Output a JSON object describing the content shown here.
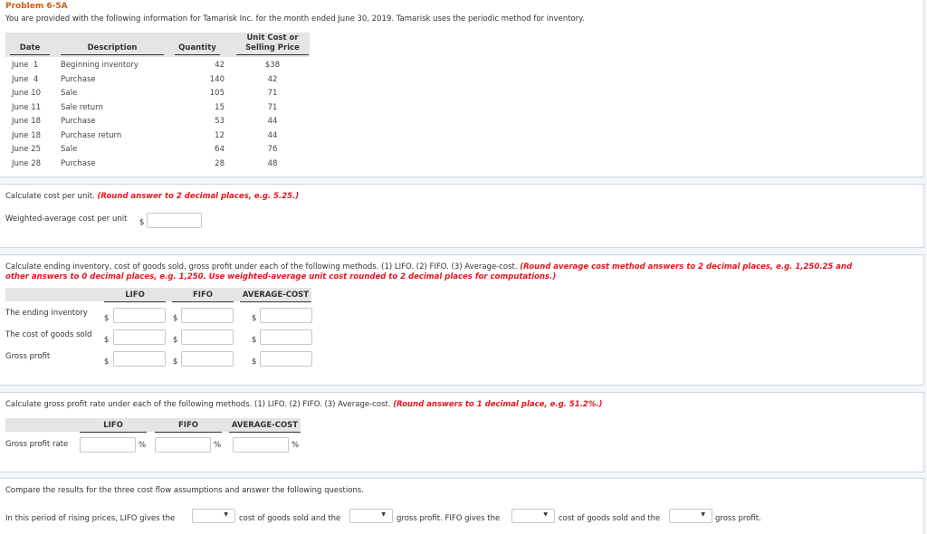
{
  "problem": {
    "title": "Problem 6-5A",
    "intro": "You are provided with the following information for Tamarisk Inc. for the month ended June 30, 2019. Tamarisk uses the periodic method for inventory."
  },
  "table": {
    "headers": {
      "date": "Date",
      "description": "Description",
      "quantity": "Quantity",
      "unit_cost_line1": "Unit Cost or",
      "unit_cost_line2": "Selling Price"
    },
    "rows": [
      {
        "date": "June  1",
        "description": "Beginning inventory",
        "quantity": "42",
        "price": "$38"
      },
      {
        "date": "June  4",
        "description": "Purchase",
        "quantity": "140",
        "price": "42"
      },
      {
        "date": "June 10",
        "description": "Sale",
        "quantity": "105",
        "price": "71"
      },
      {
        "date": "June 11",
        "description": "Sale return",
        "quantity": "15",
        "price": "71"
      },
      {
        "date": "June 18",
        "description": "Purchase",
        "quantity": "53",
        "price": "44"
      },
      {
        "date": "June 18",
        "description": "Purchase return",
        "quantity": "12",
        "price": "44"
      },
      {
        "date": "June 25",
        "description": "Sale",
        "quantity": "64",
        "price": "76"
      },
      {
        "date": "June 28",
        "description": "Purchase",
        "quantity": "28",
        "price": "48"
      }
    ]
  },
  "part1": {
    "instruction": "Calculate cost per unit.",
    "hint": "(Round answer to 2 decimal places, e.g. 5.25.)",
    "label": "Weighted-average cost per unit",
    "currency": "$",
    "value": ""
  },
  "part2": {
    "instruction": "Calculate ending inventory, cost of goods sold, gross profit under each of the following methods. (1) LIFO. (2) FIFO. (3) Average-cost.",
    "hint_line1": "(Round average cost method answers to 2 decimal places, e.g. 1,250.25 and",
    "hint_line2": "other answers to 0 decimal places, e.g. 1,250. Use weighted-average unit cost rounded to 2 decimal places for computations.)",
    "columns": [
      "LIFO",
      "FIFO",
      "AVERAGE-COST"
    ],
    "currency": "$",
    "rows": [
      {
        "label": "The ending inventory",
        "values": [
          "",
          "",
          ""
        ]
      },
      {
        "label": "The cost of goods sold",
        "values": [
          "",
          "",
          ""
        ]
      },
      {
        "label": "Gross profit",
        "values": [
          "",
          "",
          ""
        ]
      }
    ]
  },
  "part3": {
    "instruction": "Calculate gross profit rate under each of the following methods. (1) LIFO. (2) FIFO. (3) Average-cost.",
    "hint": "(Round answers to 1 decimal place, e.g. 51.2%.)",
    "columns": [
      "LIFO",
      "FIFO",
      "AVERAGE-COST"
    ],
    "row_label": "Gross profit rate",
    "unit": "%",
    "values": [
      "",
      "",
      ""
    ]
  },
  "part4": {
    "instruction": "Compare the results for the three cost flow assumptions and answer the following questions.",
    "sentence": {
      "seg1": "In this period of rising prices, LIFO gives the",
      "seg2": "cost of goods sold and the",
      "seg3": "gross profit. FIFO gives the",
      "seg4": "cost of goods sold and the",
      "seg5": "gross profit."
    },
    "selects": [
      "",
      "",
      "",
      ""
    ],
    "arrow": "▼"
  }
}
